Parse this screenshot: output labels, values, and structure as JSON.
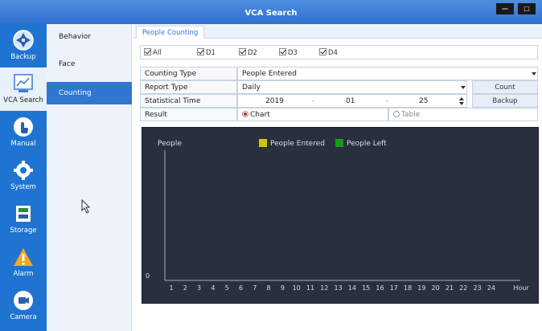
{
  "window": {
    "title": "VCA Search",
    "min_label": "—",
    "close_label": "□"
  },
  "nav": [
    {
      "label": "Backup",
      "icon": "backup-icon"
    },
    {
      "label": "VCA Search",
      "icon": "vca-search-icon"
    },
    {
      "label": "Manual",
      "icon": "manual-icon"
    },
    {
      "label": "System",
      "icon": "gear-icon"
    },
    {
      "label": "Storage",
      "icon": "storage-icon"
    },
    {
      "label": "Alarm",
      "icon": "alarm-icon"
    },
    {
      "label": "Camera",
      "icon": "camera-icon"
    }
  ],
  "submenu": [
    {
      "label": "Behavior"
    },
    {
      "label": "Face"
    },
    {
      "label": "Counting"
    }
  ],
  "tab": {
    "label": "People Counting"
  },
  "channels": [
    "All",
    "D1",
    "D2",
    "D3",
    "D4"
  ],
  "form": {
    "counting_type": {
      "label": "Counting Type",
      "value": "People Entered"
    },
    "report_type": {
      "label": "Report Type",
      "value": "Daily"
    },
    "statistical_time": {
      "label": "Statistical Time",
      "year": "2019",
      "month": "01",
      "day": "25",
      "sep": "-"
    },
    "result": {
      "label": "Result",
      "option_chart": "Chart",
      "option_table": "Table"
    }
  },
  "buttons": {
    "count": "Count",
    "backup": "Backup"
  },
  "colors": {
    "entered": "#c8c800",
    "left": "#1a9a1a",
    "chart_bg": "#2a2f3d",
    "accent": "#2f78d2"
  },
  "chart_data": {
    "type": "bar",
    "ylabel": "People",
    "xlabel": "Hour",
    "y_tick": "0",
    "categories": [
      "1",
      "2",
      "3",
      "4",
      "5",
      "6",
      "7",
      "8",
      "9",
      "10",
      "11",
      "12",
      "13",
      "14",
      "15",
      "16",
      "17",
      "18",
      "19",
      "20",
      "21",
      "22",
      "23",
      "24"
    ],
    "series": [
      {
        "name": "People Entered",
        "values": []
      },
      {
        "name": "People Left",
        "values": []
      }
    ]
  }
}
